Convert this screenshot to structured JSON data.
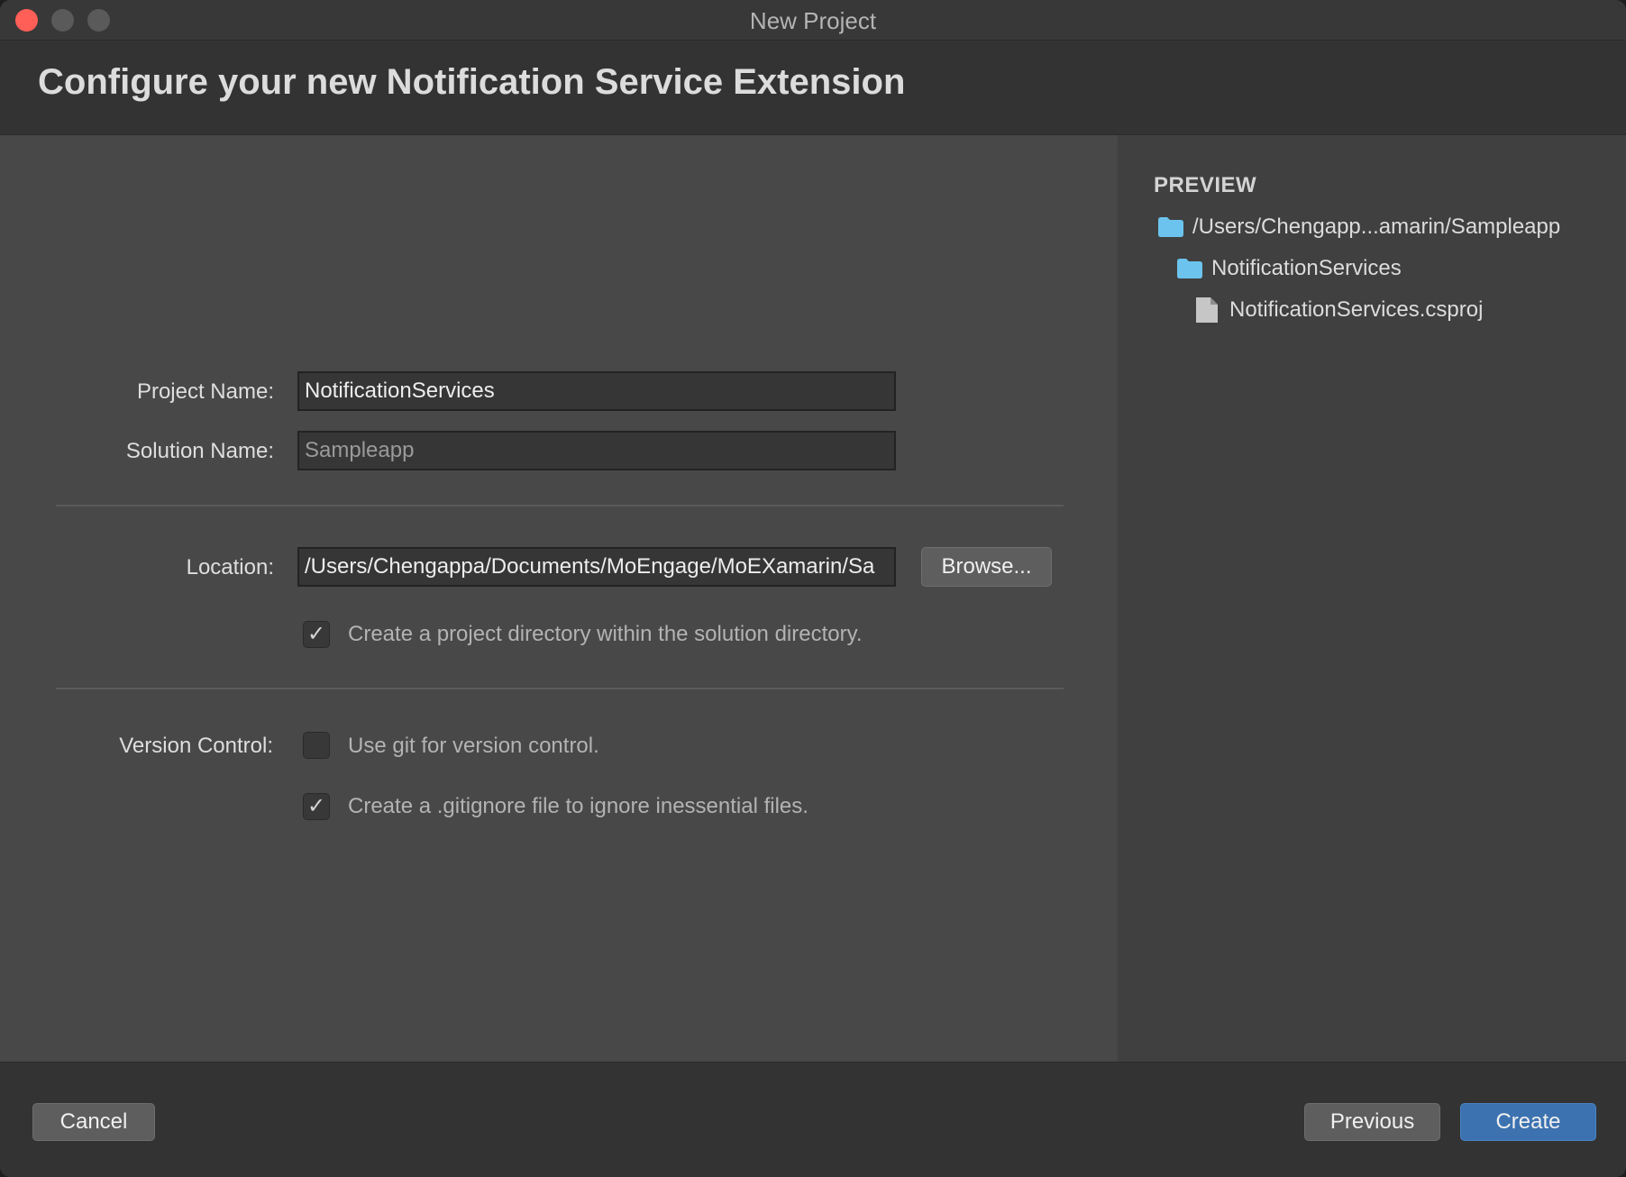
{
  "window": {
    "title": "New Project"
  },
  "header": {
    "title": "Configure your new Notification Service Extension"
  },
  "form": {
    "project_name_label": "Project Name:",
    "project_name_value": "NotificationServices",
    "solution_name_label": "Solution Name:",
    "solution_name_value": "Sampleapp",
    "location_label": "Location:",
    "location_value": "/Users/Chengappa/Documents/MoEngage/MoEXamarin/Sa",
    "browse_label": "Browse...",
    "create_project_dir": {
      "checked": true,
      "label": "Create a project directory within the solution directory."
    },
    "version_control_label": "Version Control:",
    "use_git": {
      "checked": false,
      "label": "Use git for version control."
    },
    "gitignore": {
      "checked": true,
      "label": "Create a .gitignore file to ignore inessential files."
    }
  },
  "preview": {
    "heading": "PREVIEW",
    "items": [
      {
        "icon": "folder-icon",
        "label": "/Users/Chengapp...amarin/Sampleapp"
      },
      {
        "icon": "folder-icon",
        "label": "NotificationServices"
      },
      {
        "icon": "file-icon",
        "label": "NotificationServices.csproj"
      }
    ]
  },
  "footer": {
    "cancel_label": "Cancel",
    "previous_label": "Previous",
    "create_label": "Create"
  },
  "colors": {
    "accent": "#3c72b0",
    "folder": "#6cc4ee",
    "close": "#ff5f57"
  }
}
